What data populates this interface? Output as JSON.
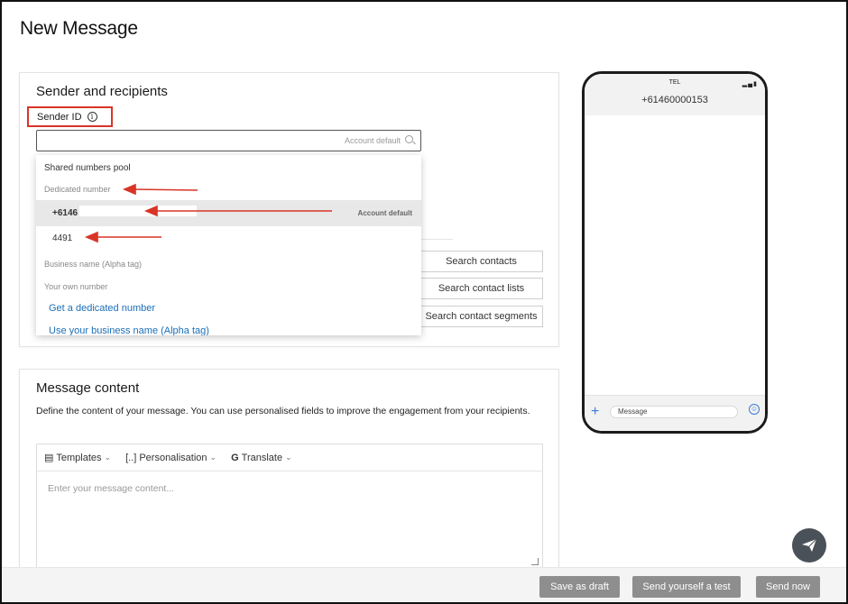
{
  "page": {
    "title": "New Message"
  },
  "sender_section": {
    "title": "Sender and recipients",
    "sender_id_label": "Sender ID",
    "select_hint": "Account default",
    "search_buttons": [
      "Search contacts",
      "Search contact lists",
      "Search contact segments"
    ]
  },
  "dropdown": {
    "shared_pool": "Shared numbers pool",
    "dedicated_group": "Dedicated number",
    "selected_number": "+6146",
    "selected_badge": "Account default",
    "second_number": "4491",
    "alpha_group": "Business name (Alpha tag)",
    "own_group": "Your own number",
    "link_dedicated": "Get a dedicated number",
    "link_business": "Use your business name (Alpha tag)"
  },
  "content_section": {
    "title": "Message content",
    "description": "Define the content of your message. You can use personalised fields to improve the engagement from your recipients.",
    "toolbar": [
      "Templates",
      "Personalisation",
      "Translate"
    ],
    "placeholder": "Enter your message content..."
  },
  "phone": {
    "carrier": "TEL",
    "number": "+61460000153",
    "message_placeholder": "Message"
  },
  "footer": {
    "save_draft": "Save as draft",
    "send_test": "Send yourself a test",
    "send_now": "Send now"
  },
  "colors": {
    "highlight": "#d83427",
    "link": "#1a6fb8",
    "footer_button": "#8e8e8e"
  },
  "icons": [
    "info-icon",
    "search-icon",
    "templates-icon",
    "personalisation-icon",
    "translate-icon",
    "plus-icon",
    "emoji-icon",
    "send-icon"
  ]
}
